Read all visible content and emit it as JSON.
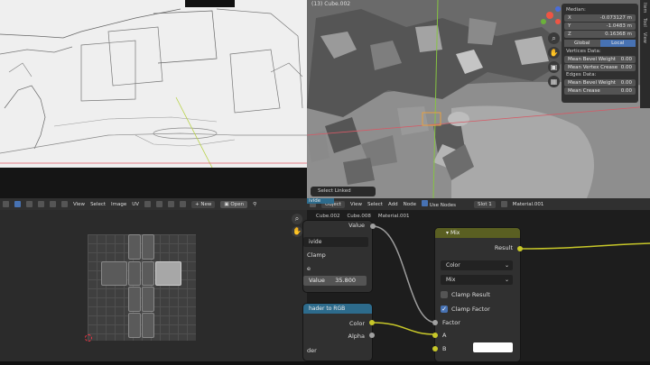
{
  "viewport3d": {
    "title": "(13) Cube.002",
    "npanel": {
      "median_label": "Median:",
      "x_label": "X",
      "x_value": "-0.073127 m",
      "y_label": "Y",
      "y_value": "-1.0483 m",
      "z_label": "Z",
      "z_value": "0.16368 m",
      "global": "Global",
      "local": "Local",
      "vertices_header": "Vertices Data:",
      "mean_bevel_weight": "Mean Bevel Weight",
      "mean_bevel_weight_value": "0.00",
      "mean_vertex_crease": "Mean Vertex Crease",
      "mean_vertex_crease_value": "0.00",
      "edges_header": "Edges Data:",
      "edge_mean_bevel_weight": "Mean Bevel Weight",
      "edge_mean_bevel_weight_value": "0.00",
      "mean_crease": "Mean Crease",
      "mean_crease_value": "0.00"
    },
    "side_tabs": [
      "Item",
      "Tool",
      "View"
    ],
    "select_linked": "Select Linked"
  },
  "uv_editor": {
    "menu": [
      "View",
      "Select",
      "Image",
      "UV"
    ],
    "new_label": "New",
    "open_label": "Open"
  },
  "node_editor": {
    "object_mode": "Object",
    "menu": [
      "View",
      "Select",
      "Add",
      "Node"
    ],
    "use_nodes": "Use Nodes",
    "slot": "Slot 1",
    "material": "Material.001",
    "breadcrumbs": [
      "Cube.002",
      "Cube.008",
      "Material.001"
    ],
    "value_node": {
      "output_label": "Value",
      "divide_header": "ivide",
      "divide_op": "ivide",
      "clamp_label": "Clamp",
      "value_partial": "e",
      "value_field_label": "Value",
      "value_field_value": "35.800"
    },
    "shader_rgb_node": {
      "title": "hader to RGB",
      "color_label": "Color",
      "alpha_label": "Alpha",
      "shader_label": "der"
    },
    "mix_node": {
      "title": "Mix",
      "result_label": "Result",
      "data_type": "Color",
      "blend_mode": "Mix",
      "clamp_result": "Clamp Result",
      "clamp_factor": "Clamp Factor",
      "factor_label": "Factor",
      "a_label": "A",
      "b_label": "B",
      "b_color": "#ffffff"
    }
  },
  "colors": {
    "accent_blue": "#4772b3",
    "socket_yellow": "#c7c729",
    "mix_header": "#5a5f22",
    "shader_header": "#2d6b8c"
  }
}
